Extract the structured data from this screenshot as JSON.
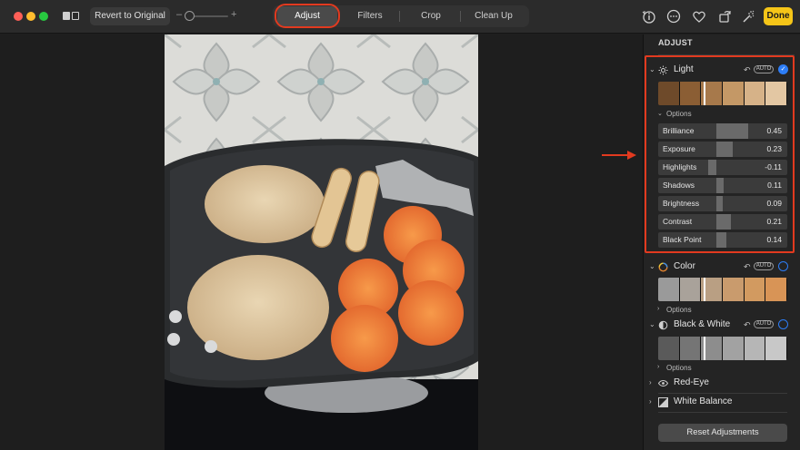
{
  "toolbar": {
    "revert_label": "Revert to Original",
    "zoom_minus": "–",
    "zoom_plus": "+",
    "tabs": [
      {
        "label": "Adjust",
        "active": true
      },
      {
        "label": "Filters",
        "active": false
      },
      {
        "label": "Crop",
        "active": false
      },
      {
        "label": "Clean Up",
        "active": false
      }
    ],
    "done_label": "Done",
    "icons": [
      "compare-icon",
      "info-icon",
      "more-icon",
      "favorite-icon",
      "rotate-icon",
      "magic-wand-icon"
    ],
    "accent_color": "#f5c518",
    "highlight_color": "#e23a1f"
  },
  "sidebar": {
    "title": "ADJUST",
    "light": {
      "label": "Light",
      "auto_label": "AUTO",
      "enabled": true,
      "options_label": "Options",
      "sliders": [
        {
          "label": "Brilliance",
          "value": "0.45",
          "amount": 0.45
        },
        {
          "label": "Exposure",
          "value": "0.23",
          "amount": 0.23
        },
        {
          "label": "Highlights",
          "value": "-0.11",
          "amount": -0.11
        },
        {
          "label": "Shadows",
          "value": "0.11",
          "amount": 0.11
        },
        {
          "label": "Brightness",
          "value": "0.09",
          "amount": 0.09
        },
        {
          "label": "Contrast",
          "value": "0.21",
          "amount": 0.21
        },
        {
          "label": "Black Point",
          "value": "0.14",
          "amount": 0.14
        }
      ]
    },
    "color": {
      "label": "Color",
      "auto_label": "AUTO",
      "enabled": false,
      "options_label": "Options"
    },
    "black_white": {
      "label": "Black & White",
      "auto_label": "AUTO",
      "enabled": false,
      "options_label": "Options"
    },
    "red_eye": {
      "label": "Red-Eye"
    },
    "white_balance": {
      "label": "White Balance"
    },
    "reset_label": "Reset Adjustments"
  }
}
